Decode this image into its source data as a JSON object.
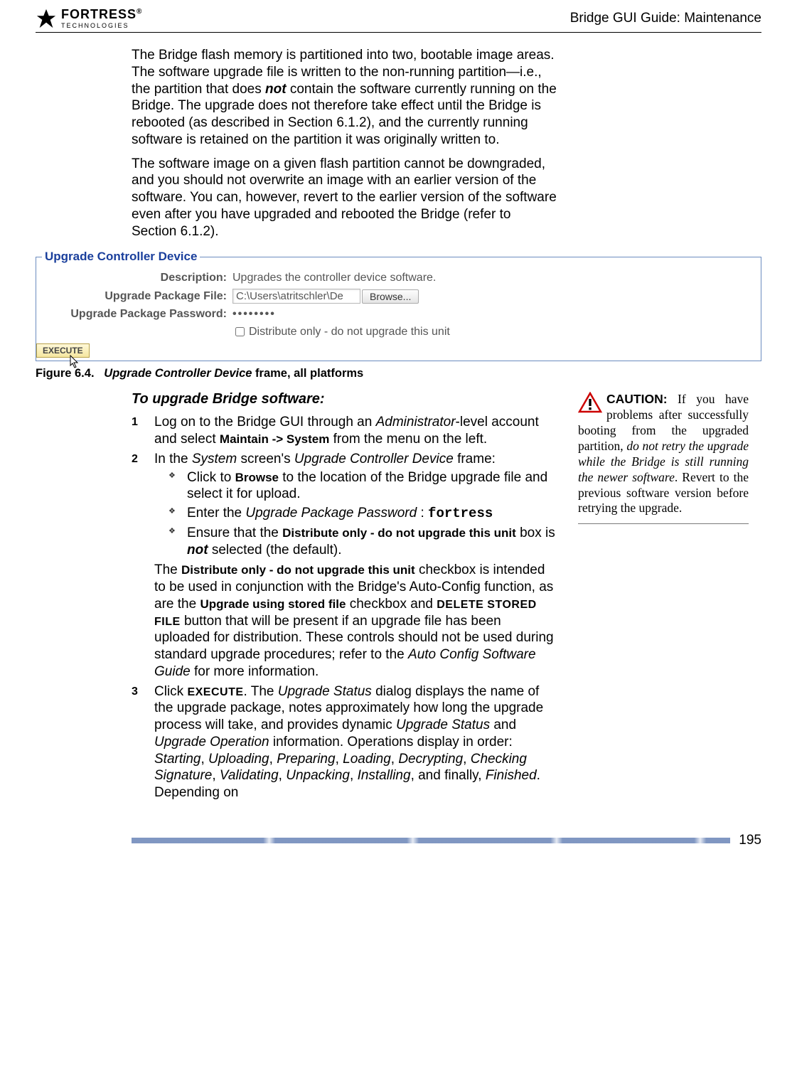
{
  "header": {
    "logo_text": "FORTRESS",
    "logo_sub": "TECHNOLOGIES",
    "right": "Bridge GUI Guide: Maintenance"
  },
  "intro": {
    "p1_a": "The Bridge flash memory is partitioned into two, bootable image areas. The software upgrade file is written to the non-running partition—i.e., the partition that does ",
    "p1_not": "not",
    "p1_b": " contain the software currently running on the Bridge. The upgrade does not therefore take effect until the Bridge is rebooted (as described in Section 6.1.2), and the currently running software is retained on the partition it was originally written to.",
    "p2": "The software image on a given flash partition cannot be downgraded, and you should not overwrite an image with an earlier version of the software. You can, however, revert to the earlier version of the software even after you have upgraded and rebooted the Bridge (refer to Section 6.1.2)."
  },
  "screenshot": {
    "legend": "Upgrade Controller Device",
    "desc_label": "Description:",
    "desc_value": "Upgrades the controller device software.",
    "file_label": "Upgrade Package File:",
    "file_value": "C:\\Users\\atritschler\\De",
    "browse": "Browse...",
    "pw_label": "Upgrade Package Password:",
    "pw_value": "••••••••",
    "dist_label": "Distribute only - do not upgrade this unit",
    "execute": "EXECUTE"
  },
  "figure": {
    "label": "Figure 6.4.",
    "title_em": "Upgrade Controller Device",
    "title_rest": " frame, all platforms"
  },
  "procedure": {
    "heading": "To upgrade Bridge software:",
    "step1_a": "Log on to the Bridge GUI through an ",
    "step1_admin": "Administrator",
    "step1_b": "-level account and select ",
    "step1_menu": "Maintain -> System",
    "step1_c": " from the menu on the left.",
    "step2_a": "In the ",
    "step2_sys": "System",
    "step2_b": " screen's ",
    "step2_ucd": "Upgrade Controller Device",
    "step2_c": " frame:",
    "sub1_a": "Click to ",
    "sub1_browse": "Browse",
    "sub1_b": " to the location of the Bridge upgrade file and select it for upload.",
    "sub2_a": "Enter the ",
    "sub2_upp": "Upgrade Package Password",
    "sub2_colon": " : ",
    "sub2_val": "fortress",
    "sub3_a": "Ensure that the ",
    "sub3_dist": "Distribute only - do not upgrade this unit",
    "sub3_b": " box is ",
    "sub3_not": "not",
    "sub3_c": " selected (the default).",
    "note_a": "The ",
    "note_dist": "Distribute only - do not upgrade this unit",
    "note_b": " checkbox is intended to be used in conjunction with the Bridge's Auto-Config function, as are the ",
    "note_upg": "Upgrade using stored file",
    "note_c": " checkbox and ",
    "note_del": "DELETE STORED FILE",
    "note_d": " button that will be present if an upgrade file has been uploaded for distribution. These controls should not be used during standard upgrade procedures; refer to the ",
    "note_guide": "Auto Config Software Guide",
    "note_e": " for more information.",
    "step3_a": "Click ",
    "step3_exec": "EXECUTE",
    "step3_b": ". The ",
    "step3_us": "Upgrade Status",
    "step3_c": " dialog displays the name of the upgrade package, notes approximately how long the upgrade process will take, and provides dynamic ",
    "step3_us2": "Upgrade Status",
    "step3_d": " and ",
    "step3_uo": "Upgrade Operation",
    "step3_e": " information. Operations display in order: ",
    "op1": "Starting",
    "op_c": ", ",
    "op2": "Uploading",
    "op3": "Preparing",
    "op4": "Loading",
    "op5": "Decrypting",
    "op6": "Checking Signature",
    "op7": "Validating",
    "op8": "Unpacking",
    "op9": "Installing",
    "op_and": ", and finally, ",
    "op10": "Finished",
    "step3_f": ". Depending on"
  },
  "caution": {
    "label": "CAUTION:",
    "text_a": " If you have problems after successfully booting from the upgraded partition, ",
    "text_it": "do not retry the upgrade while the Bridge is still running the newer software",
    "text_b": ". Revert to the previous software version before retrying the upgrade."
  },
  "footer": {
    "page": "195"
  }
}
